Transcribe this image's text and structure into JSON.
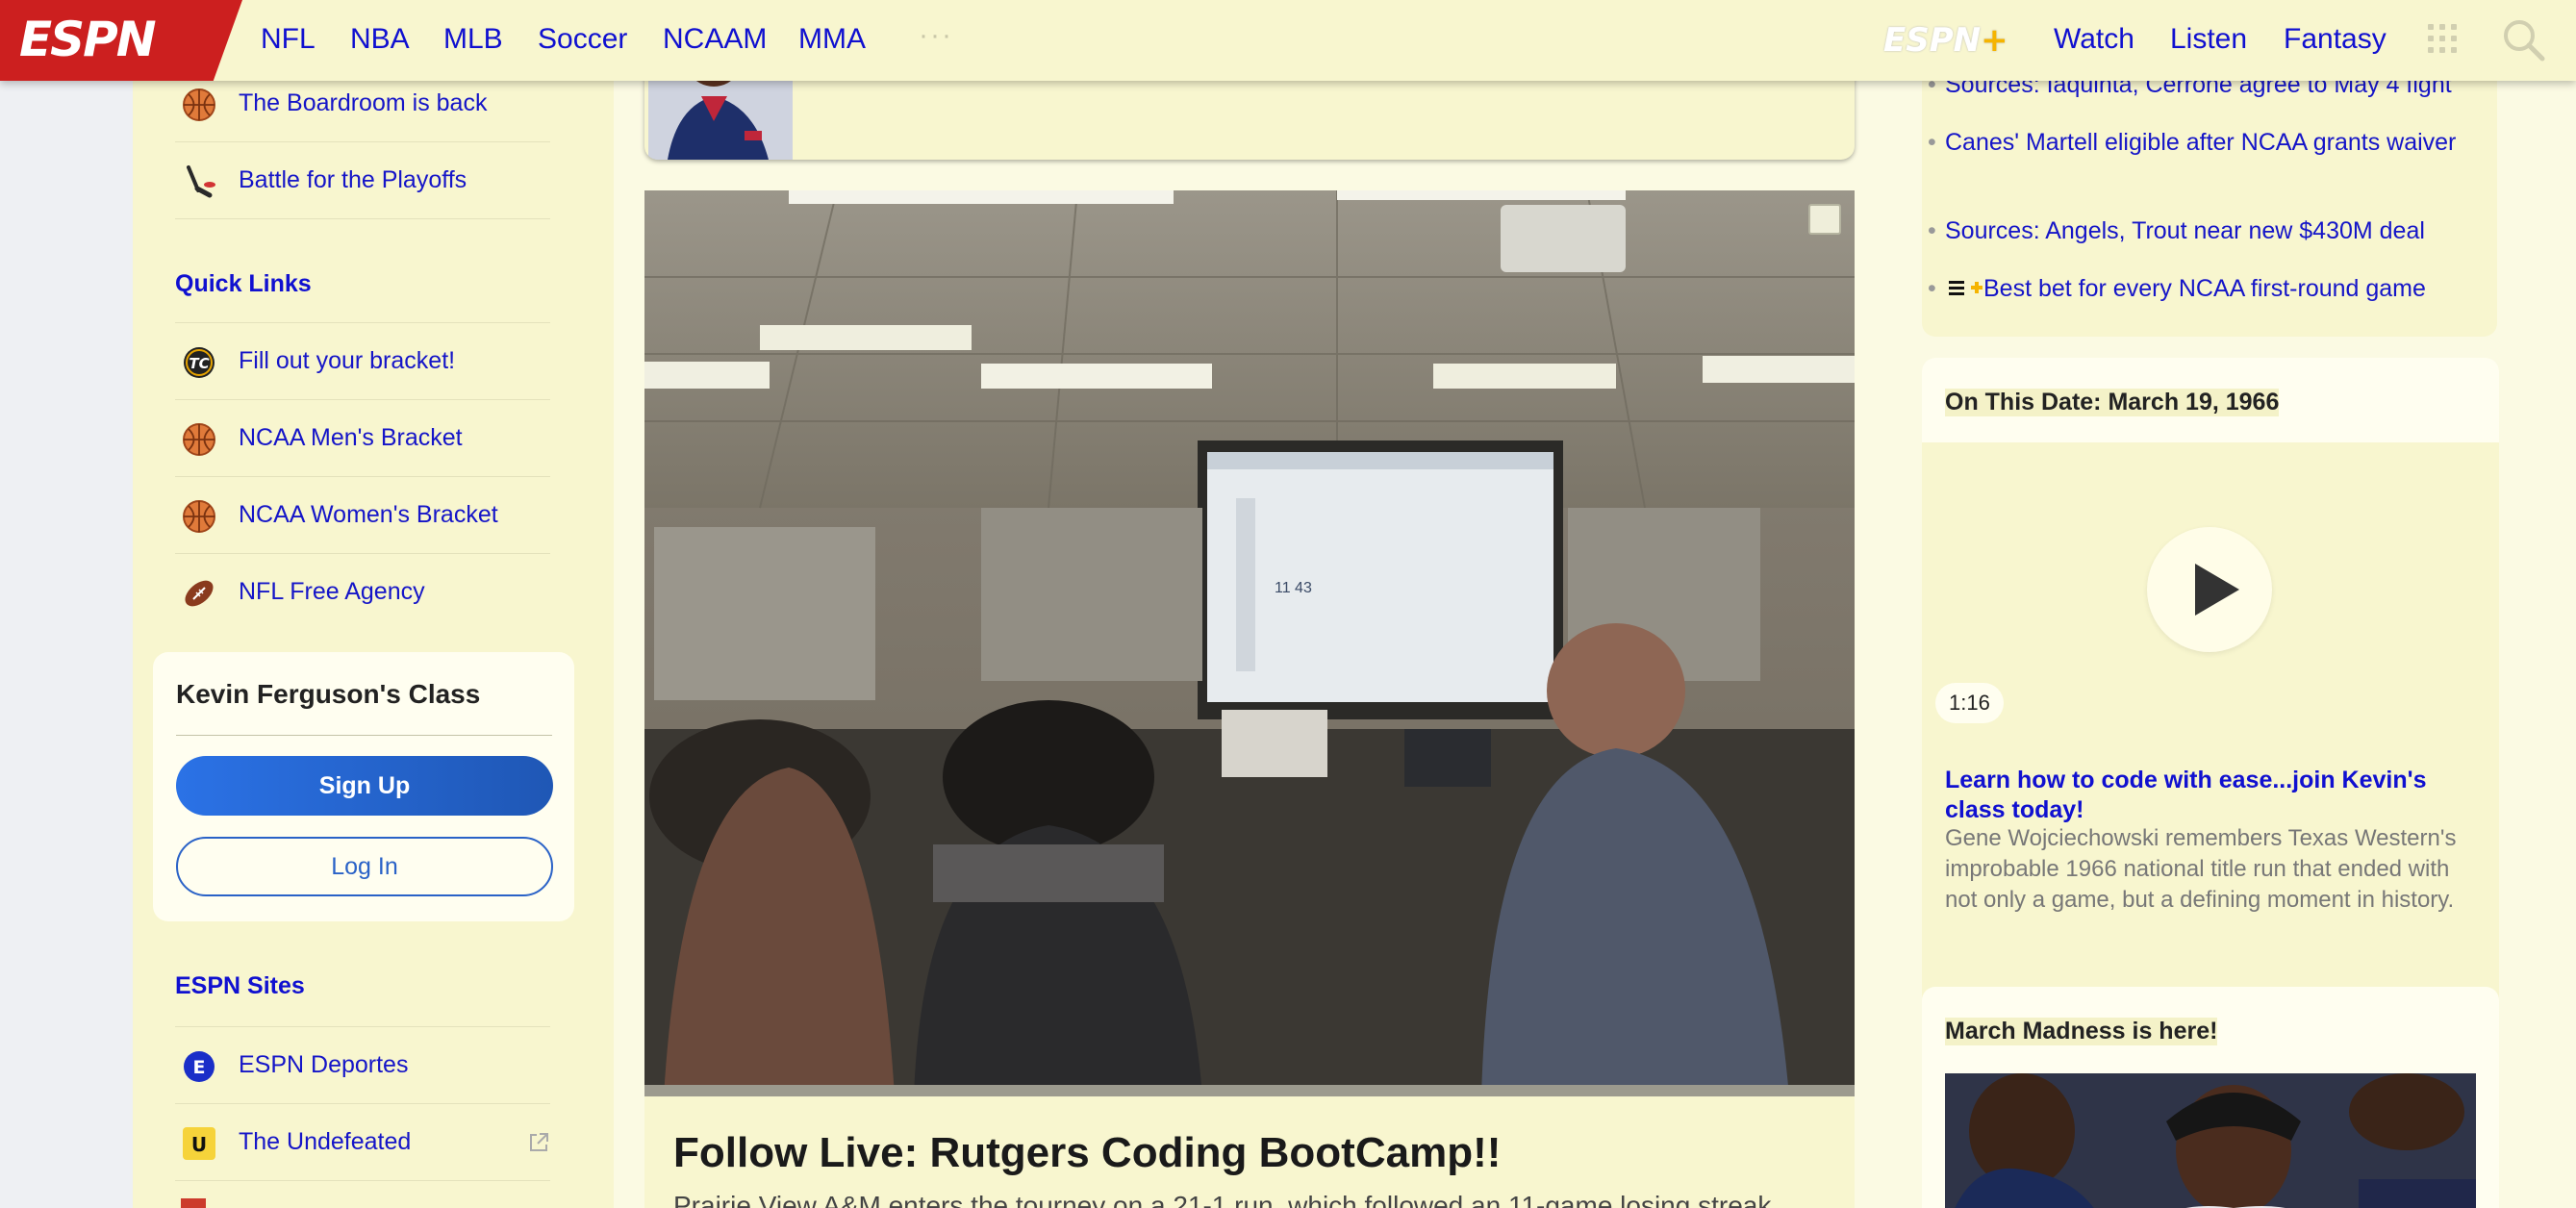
{
  "header": {
    "logo_text": "ESPN",
    "nav": [
      "NFL",
      "NBA",
      "MLB",
      "Soccer",
      "NCAAM",
      "MMA"
    ],
    "more_glyph": "···",
    "plus_logo": "ESPN",
    "plus_sign": "+",
    "right_links": [
      "Watch",
      "Listen",
      "Fantasy"
    ],
    "icons": {
      "more": "more-dots-icon",
      "apps": "grid-icon",
      "search": "search-icon"
    }
  },
  "sidebar": {
    "top_items": [
      {
        "label": "The Boardroom is back",
        "icon": "basketball-icon"
      },
      {
        "label": "Battle for the Playoffs",
        "icon": "hockey-stick-icon"
      }
    ],
    "quick_links_heading": "Quick Links",
    "quick_links": [
      {
        "label": "Fill out your bracket!",
        "icon": "tournament-challenge-icon",
        "icon_text": "TC"
      },
      {
        "label": "NCAA Men's Bracket",
        "icon": "basketball-icon"
      },
      {
        "label": "NCAA Women's Bracket",
        "icon": "basketball-icon"
      },
      {
        "label": "NFL Free Agency",
        "icon": "football-icon"
      }
    ],
    "class_card": {
      "title": "Kevin Ferguson's Class",
      "signup_label": "Sign Up",
      "login_label": "Log In"
    },
    "sites_heading": "ESPN Sites",
    "sites": [
      {
        "label": "ESPN Deportes",
        "icon": "deportes-icon",
        "icon_text": "E"
      },
      {
        "label": "The Undefeated",
        "icon": "undefeated-icon",
        "icon_text": "U"
      }
    ]
  },
  "main": {
    "headline": "Follow Live: Rutgers Coding BootCamp!!",
    "dek": "Prairie View A&M enters the tourney on a 21-1 run, which followed an 11-game losing streak."
  },
  "right": {
    "headlines": [
      "Sources: Iaquinta, Cerrone agree to May 4 fight",
      "Canes' Martell eligible after NCAA grants waiver",
      "Sources: Angels, Trout near new $430M deal",
      "Best bet for every NCAA first-round game"
    ],
    "on_this_date": {
      "title": "On This Date: March 19, 1966",
      "duration": "1:16",
      "link": "Learn how to code with ease...join Kevin's class today!",
      "description": "Gene Wojciechowski remembers Texas Western's improbable 1966 national title run that ended with not only a game, but a defining moment in history."
    },
    "march_madness_title": "March Madness is here!"
  },
  "colors": {
    "page_bg": "#f8f6cf",
    "link_blue": "#1010d0",
    "espn_red": "#cc1f1f",
    "button_blue": "#2b72e6",
    "plus_gold": "#f5b400"
  }
}
